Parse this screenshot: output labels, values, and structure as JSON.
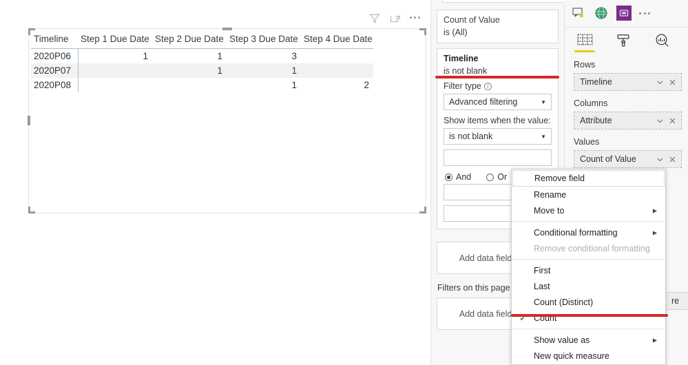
{
  "visual_toolbar": {
    "filter_icon": "filter-icon",
    "focus_icon": "focus-mode-icon",
    "more_icon": "more-options-icon"
  },
  "table_visual": {
    "columns": [
      "Timeline",
      "Step 1 Due Date",
      "Step 2 Due Date",
      "Step 3 Due Date",
      "Step 4 Due Date"
    ],
    "rows": [
      [
        "2020P06",
        "1",
        "1",
        "3",
        ""
      ],
      [
        "2020P07",
        "",
        "1",
        "1",
        ""
      ],
      [
        "2020P08",
        "",
        "",
        "1",
        "2"
      ]
    ]
  },
  "filters_pane": {
    "cards": [
      {
        "title": "Count of Value",
        "subtitle": "is (All)"
      }
    ],
    "active_card": {
      "title": "Timeline",
      "subtitle": "is not blank",
      "filter_type_label": "Filter type",
      "info_icon": "info-icon",
      "filter_type_value": "Advanced filtering",
      "show_items_label": "Show items when the value:",
      "condition_value": "is not blank",
      "value_input": "",
      "and_label": "And",
      "or_label": "Or",
      "and_selected": true,
      "second_condition_value": "",
      "second_value_input": ""
    },
    "add_fields_visual": "Add data fields here",
    "page_filters_label": "Filters on this page",
    "add_fields_page": "Add data fields here"
  },
  "visualizations_pane": {
    "gallery_icons": [
      "kpi-card-icon",
      "globe-map-icon",
      "matrix-table-icon"
    ],
    "gallery_more": "more-visuals-icon",
    "tabs": [
      {
        "name": "fields-tab",
        "icon": "fields-grid-icon",
        "selected": true
      },
      {
        "name": "format-tab",
        "icon": "paint-roller-icon",
        "selected": false
      },
      {
        "name": "analytics-tab",
        "icon": "analytics-magnifier-icon",
        "selected": false
      }
    ],
    "wells": [
      {
        "label": "Rows",
        "value": "Timeline"
      },
      {
        "label": "Columns",
        "value": "Attribute"
      },
      {
        "label": "Values",
        "value": "Count of Value"
      }
    ],
    "occluded_well_text": "re",
    "chevron_icon": "chevron-down-icon",
    "remove_icon": "close-x-icon"
  },
  "context_menu": {
    "items": [
      {
        "label": "Remove field",
        "type": "item",
        "highlighted": true
      },
      {
        "label": "Rename",
        "type": "item"
      },
      {
        "label": "Move to",
        "type": "submenu"
      },
      {
        "type": "separator"
      },
      {
        "label": "Conditional formatting",
        "type": "submenu"
      },
      {
        "label": "Remove conditional formatting",
        "type": "item",
        "disabled": true
      },
      {
        "type": "separator"
      },
      {
        "label": "First",
        "type": "item"
      },
      {
        "label": "Last",
        "type": "item"
      },
      {
        "label": "Count (Distinct)",
        "type": "item"
      },
      {
        "label": "Count",
        "type": "item",
        "checked": true
      },
      {
        "type": "separator"
      },
      {
        "label": "Show value as",
        "type": "submenu"
      },
      {
        "label": "New quick measure",
        "type": "item"
      }
    ],
    "check_icon": "checkmark-icon",
    "submenu_arrow_icon": "chevron-right-icon"
  },
  "annotations": {
    "accent_color": "#d62828",
    "lines": [
      "underline-is-not-blank",
      "underline-count"
    ]
  }
}
